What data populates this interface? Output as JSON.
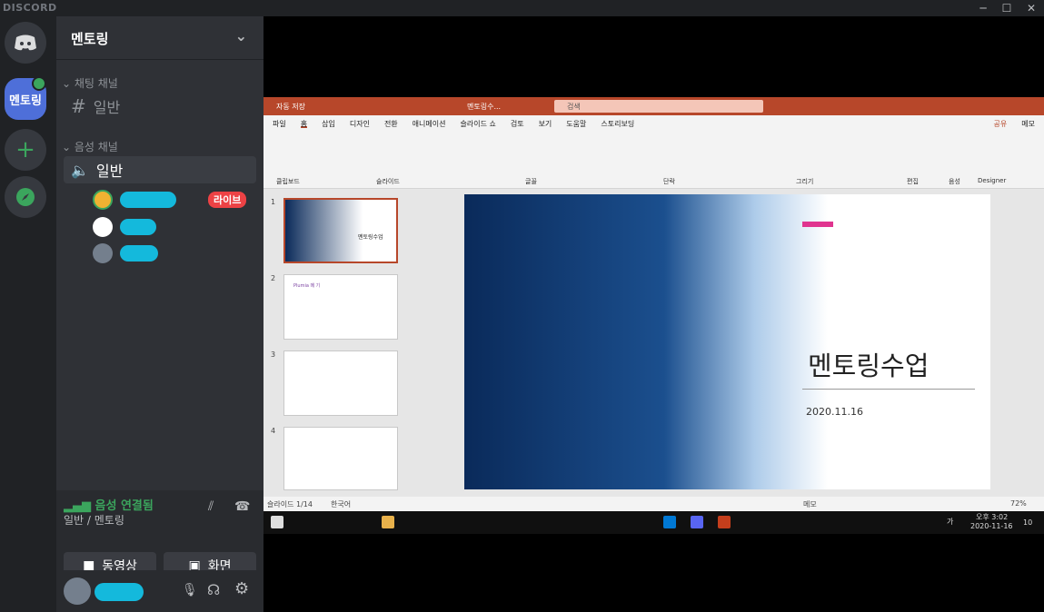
{
  "window": {
    "brand": "DISCORD",
    "min": "─",
    "max": "☐",
    "close": "✕"
  },
  "guilds": {
    "active_name": "멘토링",
    "add": "+"
  },
  "server": {
    "name": "멘토링",
    "text_category": "채팅 채널",
    "text_channel": "일반",
    "voice_category": "음성 채널",
    "voice_channel": "일반",
    "live_badge": "라이브"
  },
  "voice": {
    "status": "음성 연결됨",
    "location": "일반 / 멘토링",
    "video_button": "동영상",
    "screen_button": "화면"
  },
  "ppt": {
    "autosave": "자동 저장",
    "doc_title": "멘토링수...",
    "search": "검색",
    "tabs": [
      "파일",
      "홈",
      "삽입",
      "디자인",
      "전환",
      "애니메이션",
      "슬라이드 쇼",
      "검토",
      "보기",
      "도움말",
      "스토리보딩"
    ],
    "share": "공유",
    "memo": "메모",
    "groups": [
      "클립보드",
      "슬라이드",
      "글꼴",
      "단락",
      "그리기",
      "편집",
      "음성",
      "Designer"
    ],
    "slide_title": "멘토링수업",
    "slide_date": "2020.11.16",
    "status_left": "슬라이드 1/14",
    "status_lang": "한국어",
    "status_memo": "메모",
    "zoom": "72%",
    "thumb_titles": [
      "멘토링수업",
      "Plumia 메 기",
      "",
      ""
    ]
  },
  "taskbar": {
    "time": "오후 3:02",
    "date": "2020-11-16",
    "ime": "가",
    "notif": "10"
  },
  "colors": {
    "discord_green": "#3ba55d",
    "ppt_red": "#b7472a",
    "accent": "#e0348f"
  }
}
